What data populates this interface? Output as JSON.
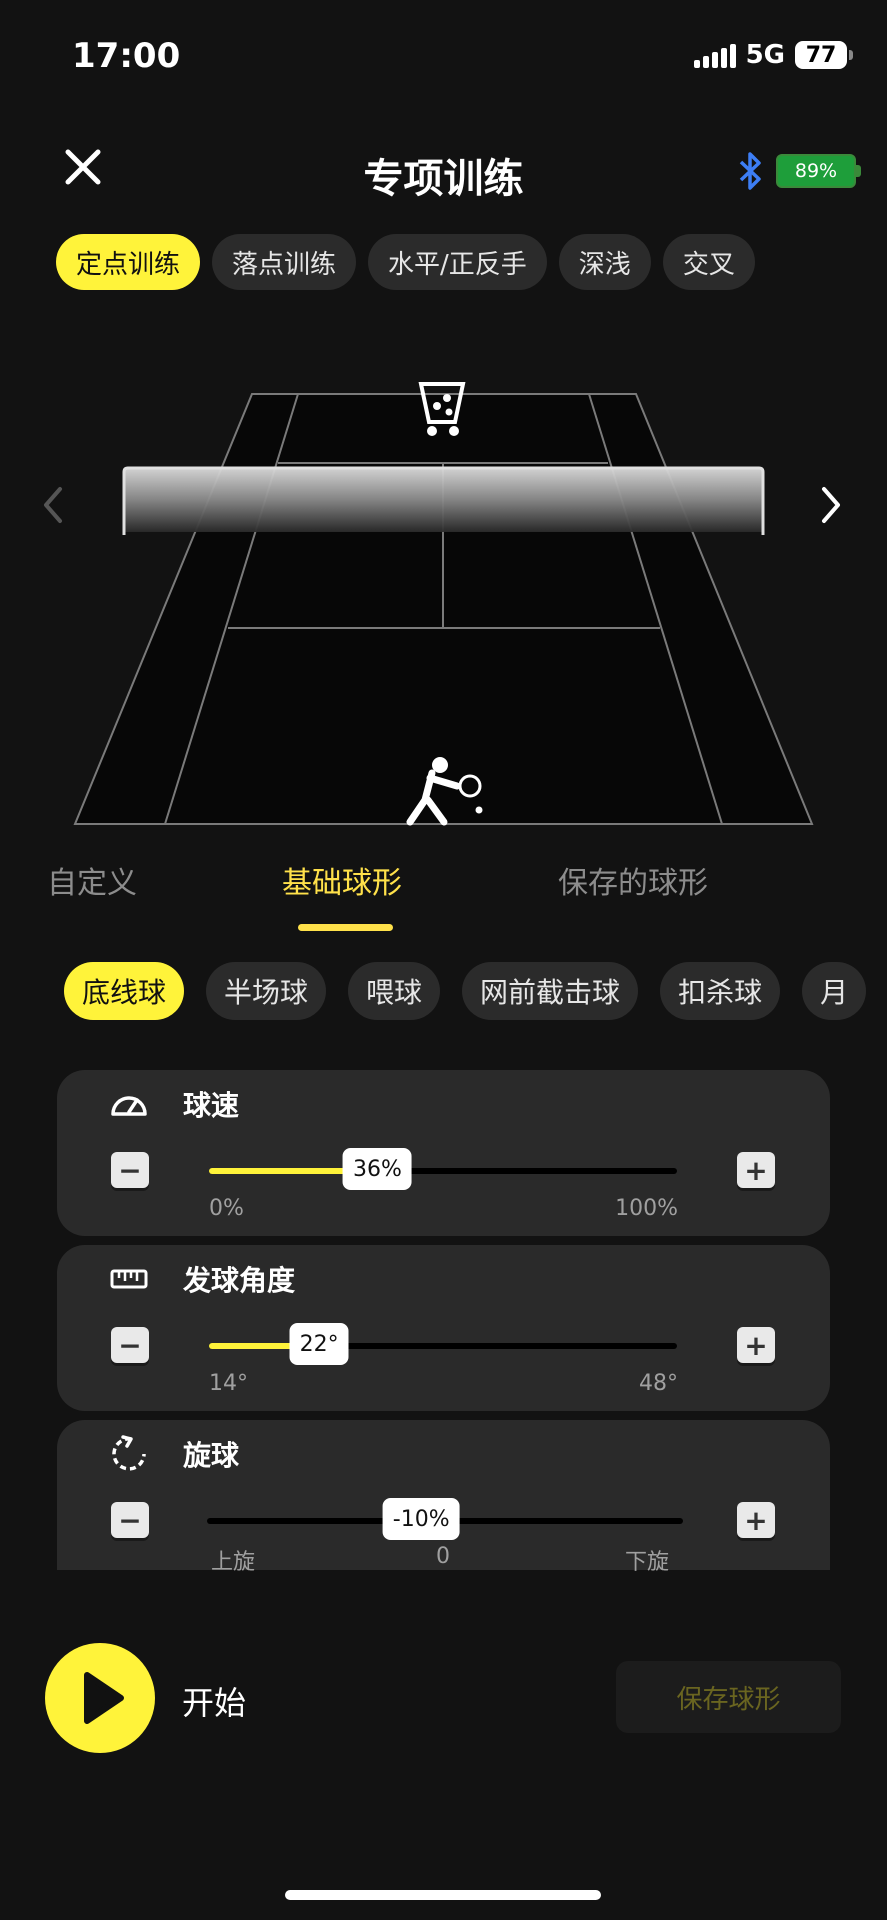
{
  "status": {
    "time": "17:00",
    "network": "5G",
    "battery": "77"
  },
  "header": {
    "title": "专项训练",
    "device_battery": "89%"
  },
  "modes": [
    {
      "label": "定点训练",
      "active": true
    },
    {
      "label": "落点训练",
      "active": false
    },
    {
      "label": "水平/正反手",
      "active": false
    },
    {
      "label": "深浅",
      "active": false
    },
    {
      "label": "交叉",
      "active": false
    }
  ],
  "tabs": {
    "custom": "自定义",
    "basic": "基础球形",
    "saved": "保存的球形"
  },
  "shots": [
    {
      "label": "底线球",
      "active": true
    },
    {
      "label": "半场球",
      "active": false
    },
    {
      "label": "喂球",
      "active": false
    },
    {
      "label": "网前截击球",
      "active": false
    },
    {
      "label": "扣杀球",
      "active": false
    },
    {
      "label": "月",
      "active": false
    }
  ],
  "controls": {
    "speed": {
      "label": "球速",
      "value_text": "36%",
      "value": 36,
      "min_label": "0%",
      "max_label": "100%"
    },
    "angle": {
      "label": "发球角度",
      "value_text": "22°",
      "value": 22,
      "min": 14,
      "max": 48,
      "min_label": "14°",
      "max_label": "48°"
    },
    "spin": {
      "label": "旋球",
      "value_text": "-10%",
      "value": -10,
      "left_label": "上旋",
      "mid_label": "0",
      "right_label": "下旋"
    }
  },
  "stepper": {
    "minus": "−",
    "plus": "+"
  },
  "bottom": {
    "start_label": "开始",
    "save_label": "保存球形"
  }
}
